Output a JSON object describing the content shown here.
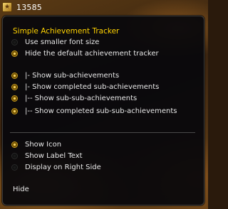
{
  "broker": {
    "icon": "achievement-shield-icon",
    "value": "13585"
  },
  "menu": {
    "title": "Simple Achievement Tracker",
    "groups": [
      [
        {
          "label": "Use smaller font size",
          "checked": false
        },
        {
          "label": "Hide the default achievement tracker",
          "checked": true
        }
      ],
      [
        {
          "label": "|- Show sub-achievements",
          "checked": true
        },
        {
          "label": "|- Show completed sub-achievements",
          "checked": true
        },
        {
          "label": "|-- Show sub-sub-achievements",
          "checked": true
        },
        {
          "label": "|-- Show completed sub-sub-achievements",
          "checked": true
        }
      ],
      [
        {
          "label": "Show Icon",
          "checked": true
        },
        {
          "label": "Show Label Text",
          "checked": false
        },
        {
          "label": "Display on Right Side",
          "checked": false
        }
      ]
    ],
    "close_label": "Hide"
  },
  "colors": {
    "title": "#ffd200",
    "text": "#e8e8e8",
    "menu_bg": "#08080c"
  }
}
